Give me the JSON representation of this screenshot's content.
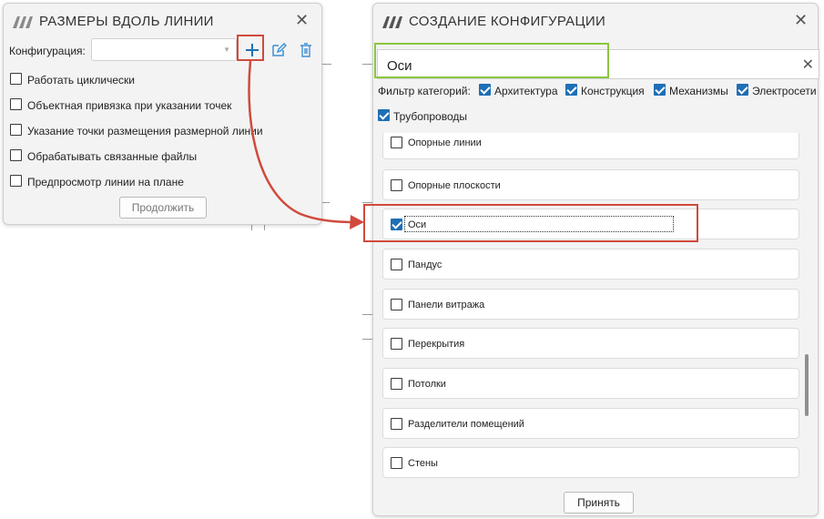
{
  "colors": {
    "accent": "#1f6fb5",
    "highlight_red": "#d04a3c",
    "highlight_green": "#8cc63f"
  },
  "dialog1": {
    "title": "РАЗМЕРЫ ВДОЛЬ ЛИНИИ",
    "close_glyph": "✕",
    "config_label": "Конфигурация:",
    "config_value": "",
    "add_icon": "plus-icon",
    "edit_icon": "edit-icon",
    "delete_icon": "trash-icon",
    "options": [
      {
        "label": "Работать циклически",
        "checked": false
      },
      {
        "label": "Объектная привязка при указании точек",
        "checked": false
      },
      {
        "label": "Указание точки размещения размерной линии",
        "checked": false
      },
      {
        "label": "Обрабатывать связанные файлы",
        "checked": false
      },
      {
        "label": "Предпросмотр линии на плане",
        "checked": false
      }
    ],
    "continue_label": "Продолжить"
  },
  "dialog2": {
    "title": "СОЗДАНИЕ КОНФИГУРАЦИИ",
    "close_glyph": "✕",
    "search_value": "Оси",
    "clear_glyph": "✕",
    "filter_label": "Фильтр категорий:",
    "filters": [
      {
        "label": "Архитектура",
        "checked": true
      },
      {
        "label": "Конструкция",
        "checked": true
      },
      {
        "label": "Механизмы",
        "checked": true
      },
      {
        "label": "Электросети",
        "checked": true
      },
      {
        "label": "Трубопроводы",
        "checked": true
      }
    ],
    "items": [
      {
        "label": "Опорные линии",
        "checked": false
      },
      {
        "label": "Опорные плоскости",
        "checked": false
      },
      {
        "label": "Оси",
        "checked": true
      },
      {
        "label": "Пандус",
        "checked": false
      },
      {
        "label": "Панели витража",
        "checked": false
      },
      {
        "label": "Перекрытия",
        "checked": false
      },
      {
        "label": "Потолки",
        "checked": false
      },
      {
        "label": "Разделители помещений",
        "checked": false
      },
      {
        "label": "Стены",
        "checked": false
      }
    ],
    "accept_label": "Принять"
  }
}
